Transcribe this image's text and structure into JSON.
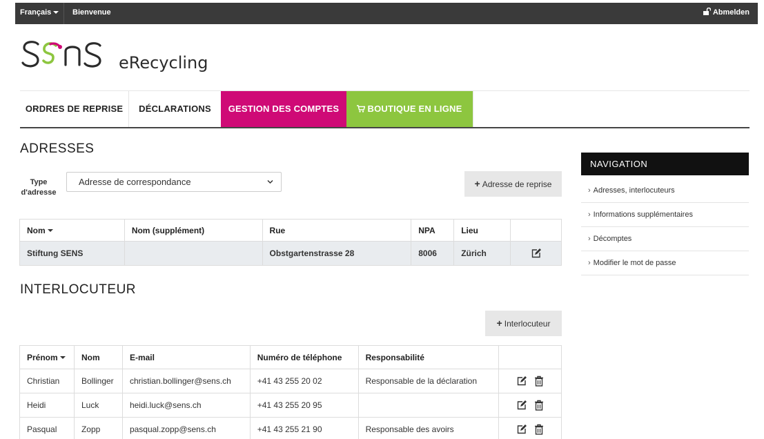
{
  "topbar": {
    "language": "Français",
    "welcome": "Bienvenue",
    "logout": "Abmelden"
  },
  "logo": {
    "brand": "SENS",
    "sub": "eRecycling"
  },
  "nav": {
    "items": [
      {
        "label": "ORDRES DE REPRISE"
      },
      {
        "label": "DÉCLARATIONS"
      },
      {
        "label": "GESTION DES COMPTES"
      },
      {
        "label": "BOUTIQUE EN LIGNE"
      }
    ]
  },
  "addresses": {
    "title": "ADRESSES",
    "type_label": "Type d'adresse",
    "type_value": "Adresse de correspondance",
    "add_button": "Adresse de reprise",
    "columns": [
      "Nom",
      "Nom (supplément)",
      "Rue",
      "NPA",
      "Lieu"
    ],
    "rows": [
      {
        "nom": "Stiftung SENS",
        "supplement": "",
        "rue": "Obstgartenstrasse 28",
        "npa": "8006",
        "lieu": "Zürich"
      }
    ]
  },
  "contacts": {
    "title": "INTERLOCUTEUR",
    "add_button": "Interlocuteur",
    "columns": [
      "Prénom",
      "Nom",
      "E-mail",
      "Numéro de téléphone",
      "Responsabilité"
    ],
    "rows": [
      {
        "prenom": "Christian",
        "nom": "Bollinger",
        "email": "christian.bollinger@sens.ch",
        "phone": "+41 43 255 20 02",
        "resp": "Responsable de la déclaration"
      },
      {
        "prenom": "Heidi",
        "nom": "Luck",
        "email": "heidi.luck@sens.ch",
        "phone": "+41 43 255 20 95",
        "resp": ""
      },
      {
        "prenom": "Pasqual",
        "nom": "Zopp",
        "email": "pasqual.zopp@sens.ch",
        "phone": "+41 43 255 21 90",
        "resp": "Responsable des avoirs"
      }
    ]
  },
  "sidebar": {
    "title": "NAVIGATION",
    "items": [
      {
        "label": "Adresses, interlocuteurs"
      },
      {
        "label": "Informations supplémentaires"
      },
      {
        "label": "Décomptes"
      },
      {
        "label": "Modifier le mot de passe"
      }
    ]
  },
  "colors": {
    "active_tab": "#cf0a76",
    "shop_tab": "#8dc63f",
    "topbar": "#3a3a3a"
  },
  "icons": [
    "lock-open-icon",
    "cart-icon",
    "plus-icon",
    "edit-icon",
    "trash-icon",
    "chevron-down-icon",
    "caret-down-icon"
  ]
}
